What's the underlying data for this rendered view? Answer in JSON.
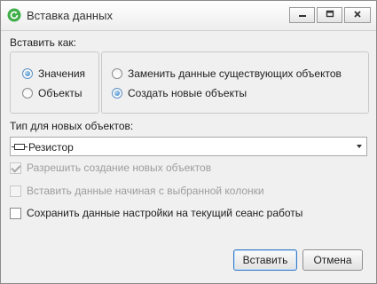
{
  "window": {
    "title": "Вставка данных",
    "icon": "refresh-icon",
    "controls": [
      "minimize-icon",
      "maximize-icon",
      "close-icon"
    ]
  },
  "paste_as": {
    "label": "Вставить как:",
    "type_options": [
      {
        "label": "Значения",
        "checked": true
      },
      {
        "label": "Объекты",
        "checked": false
      }
    ],
    "mode_options": [
      {
        "label": "Заменить данные существующих объектов",
        "checked": false
      },
      {
        "label": "Создать новые объекты",
        "checked": true
      }
    ]
  },
  "object_type": {
    "label": "Тип для новых объектов:",
    "selected": "Резистор",
    "icon": "resistor-icon"
  },
  "checkboxes": [
    {
      "label": "Разрешить создание новых объектов",
      "checked": true,
      "enabled": false
    },
    {
      "label": "Вставить данные начиная с выбранной колонки",
      "checked": false,
      "enabled": false
    },
    {
      "label": "Сохранить данные настройки на текущий сеанс работы",
      "checked": false,
      "enabled": true
    }
  ],
  "buttons": {
    "paste": "Вставить",
    "cancel": "Отмена"
  },
  "colors": {
    "accent": "#2f78bd",
    "window_bg": "#f0f0f0",
    "disabled_text": "#9d9d9d",
    "icon_green": "#3fae49"
  }
}
